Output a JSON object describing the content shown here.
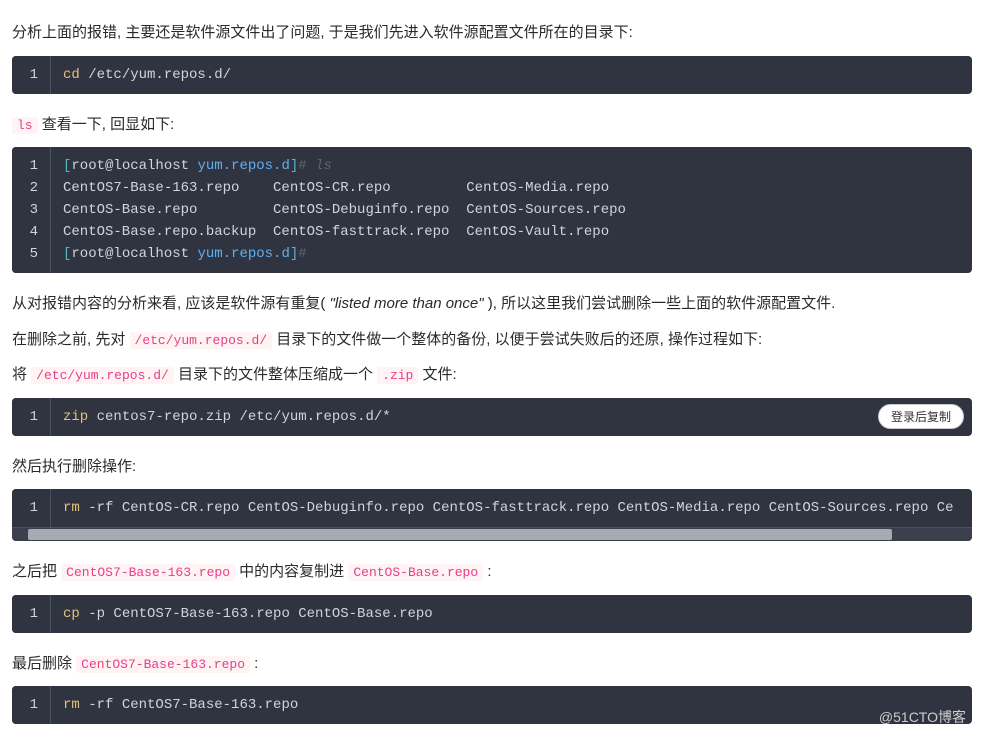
{
  "para1": "分析上面的报错, 主要还是软件源文件出了问题, 于是我们先进入软件源配置文件所在的目录下:",
  "block1": {
    "lines": [
      "1"
    ],
    "cmd": "cd",
    "arg": " /etc/yum.repos.d/"
  },
  "para2_pre": "ls",
  "para2_post": " 查看一下, 回显如下:",
  "block2": {
    "lines": [
      "1",
      "2",
      "3",
      "4",
      "5"
    ],
    "l1_b1": "[",
    "l1_user": "root@localhost",
    "l1_sp": " ",
    "l1_dir": "yum.repos.d",
    "l1_b2": "]",
    "l1_hash": "# ",
    "l1_ls": "ls",
    "l2": "CentOS7-Base-163.repo    CentOS-CR.repo         CentOS-Media.repo",
    "l3": "CentOS-Base.repo         CentOS-Debuginfo.repo  CentOS-Sources.repo",
    "l4": "CentOS-Base.repo.backup  CentOS-fasttrack.repo  CentOS-Vault.repo",
    "l5_b1": "[",
    "l5_user": "root@localhost",
    "l5_sp": " ",
    "l5_dir": "yum.repos.d",
    "l5_b2": "]",
    "l5_hash": "#"
  },
  "para3_a": "从对报错内容的分析来看, 应该是软件源有重复( ",
  "para3_q": "\"listed more than once\"",
  "para3_b": " ), 所以这里我们尝试删除一些上面的软件源配置文件.",
  "para4_a": "在删除之前, 先对 ",
  "para4_code": "/etc/yum.repos.d/",
  "para4_b": " 目录下的文件做一个整体的备份, 以便于尝试失败后的还原, 操作过程如下:",
  "para5_a": "将 ",
  "para5_code1": "/etc/yum.repos.d/",
  "para5_b": " 目录下的文件整体压缩成一个 ",
  "para5_code2": ".zip",
  "para5_c": " 文件:",
  "block3": {
    "lines": [
      "1"
    ],
    "cmd": "zip",
    "arg": " centos7-repo.zip /etc/yum.repos.d/*",
    "copy": "登录后复制"
  },
  "para6": "然后执行删除操作:",
  "block4": {
    "lines": [
      "1"
    ],
    "cmd": "rm",
    "arg": " -rf CentOS-CR.repo CentOS-Debuginfo.repo CentOS-fasttrack.repo CentOS-Media.repo CentOS-Sources.repo Ce"
  },
  "para7_a": "之后把 ",
  "para7_code1": "CentOS7-Base-163.repo",
  "para7_b": " 中的内容复制进 ",
  "para7_code2": "CentOS-Base.repo",
  "para7_c": " :",
  "block5": {
    "lines": [
      "1"
    ],
    "cmd": "cp",
    "arg": " -p CentOS7-Base-163.repo CentOS-Base.repo"
  },
  "para8_a": "最后删除 ",
  "para8_code": "CentOS7-Base-163.repo",
  "para8_b": " :",
  "block6": {
    "lines": [
      "1"
    ],
    "cmd": "rm",
    "arg": " -rf CentOS7-Base-163.repo"
  },
  "watermark": "@51CTO博客"
}
